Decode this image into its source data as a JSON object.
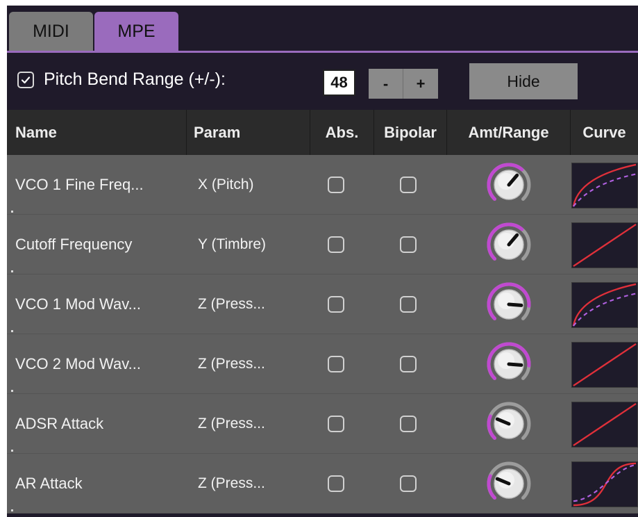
{
  "tabs": [
    {
      "label": "MIDI",
      "active": false
    },
    {
      "label": "MPE",
      "active": true
    }
  ],
  "pitch_bend": {
    "enabled": true,
    "label": "Pitch Bend Range (+/-):",
    "value": "48",
    "decrement_label": "-",
    "increment_label": "+"
  },
  "hide_label": "Hide",
  "columns": {
    "name": "Name",
    "param": "Param",
    "abs": "Abs.",
    "bipolar": "Bipolar",
    "amt_range": "Amt/Range",
    "curve": "Curve"
  },
  "rows": [
    {
      "name": "VCO 1 Fine Freq...",
      "param": "X (Pitch)",
      "abs": false,
      "bipolar": false,
      "amount": 0.65,
      "curve": "concave-dashed"
    },
    {
      "name": "Cutoff Frequency",
      "param": "Y (Timbre)",
      "abs": false,
      "bipolar": false,
      "amount": 0.65,
      "curve": "linear"
    },
    {
      "name": "VCO 1 Mod Wav...",
      "param": "Z (Press...",
      "abs": false,
      "bipolar": false,
      "amount": 0.85,
      "curve": "concave-dashed"
    },
    {
      "name": "VCO 2 Mod Wav...",
      "param": "Z (Press...",
      "abs": false,
      "bipolar": false,
      "amount": 0.85,
      "curve": "linear"
    },
    {
      "name": "ADSR Attack",
      "param": "Z (Press...",
      "abs": false,
      "bipolar": false,
      "amount": 0.25,
      "curve": "linear"
    },
    {
      "name": "AR Attack",
      "param": "Z (Press...",
      "abs": false,
      "bipolar": false,
      "amount": 0.25,
      "curve": "sigmoid-dashed"
    }
  ],
  "colors": {
    "accent": "#9a6bbd",
    "knob_arc": "#c04ad0",
    "curve_line": "#e0303a",
    "curve_dashed": "#b060e0"
  }
}
